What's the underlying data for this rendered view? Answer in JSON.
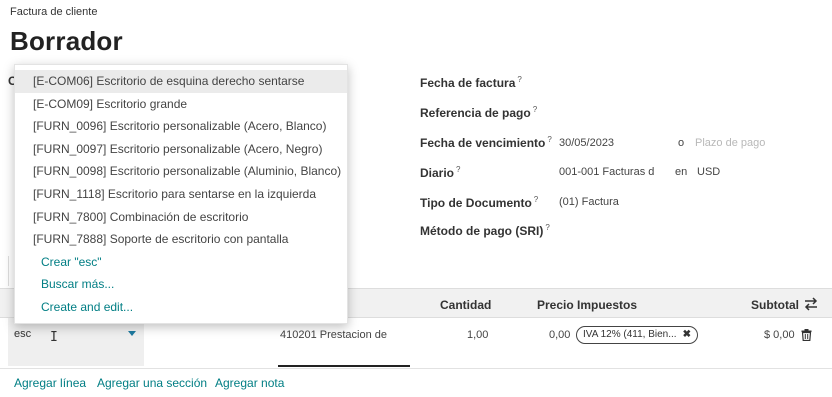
{
  "header": {
    "breadcrumb": "Factura de cliente",
    "title": "Borrador",
    "partial_label": "C"
  },
  "form": {
    "fecha_factura_label": "Fecha de factura",
    "referencia_pago_label": "Referencia de pago",
    "fecha_vencimiento_label": "Fecha de vencimiento",
    "fecha_vencimiento_value": "30/05/2023",
    "or_label": "o",
    "plazo_pago_placeholder": "Plazo de pago",
    "diario_label": "Diario",
    "diario_value": "001-001 Facturas d",
    "en_label": "en",
    "currency": "USD",
    "tipo_documento_label": "Tipo de Documento",
    "tipo_documento_value": "(01) Factura",
    "metodo_pago_label": "Método de pago (SRI)",
    "help_mark": "?"
  },
  "dropdown": {
    "items": [
      "[E-COM06] Escritorio de esquina derecho sentarse",
      "[E-COM09] Escritorio grande",
      "[FURN_0096] Escritorio personalizable (Acero, Blanco)",
      "[FURN_0097] Escritorio personalizable (Acero, Negro)",
      "[FURN_0098] Escritorio personalizable (Aluminio, Blanco)",
      "[FURN_1118] Escritorio para sentarse en la izquierda",
      "[FURN_7800] Combinación de escritorio",
      "[FURN_7888] Soporte de escritorio con pantalla"
    ],
    "create_label": "Crear \"esc\"",
    "search_more_label": "Buscar más...",
    "create_edit_label": "Create and edit..."
  },
  "table": {
    "headers": {
      "cantidad": "Cantidad",
      "precio": "Precio",
      "impuestos": "Impuestos",
      "subtotal": "Subtotal"
    },
    "row": {
      "product_input": "esc",
      "account": "410201 Prestacion de",
      "cantidad": "1,00",
      "precio": "0,00",
      "tax_tag": "IVA 12% (411, Bien...",
      "subtotal": "$ 0,00"
    }
  },
  "footer": {
    "add_line": "Agregar línea",
    "add_section": "Agregar una sección",
    "add_note": "Agregar nota"
  },
  "colors": {
    "link": "#017e84",
    "highlight": "#ebebeb"
  }
}
